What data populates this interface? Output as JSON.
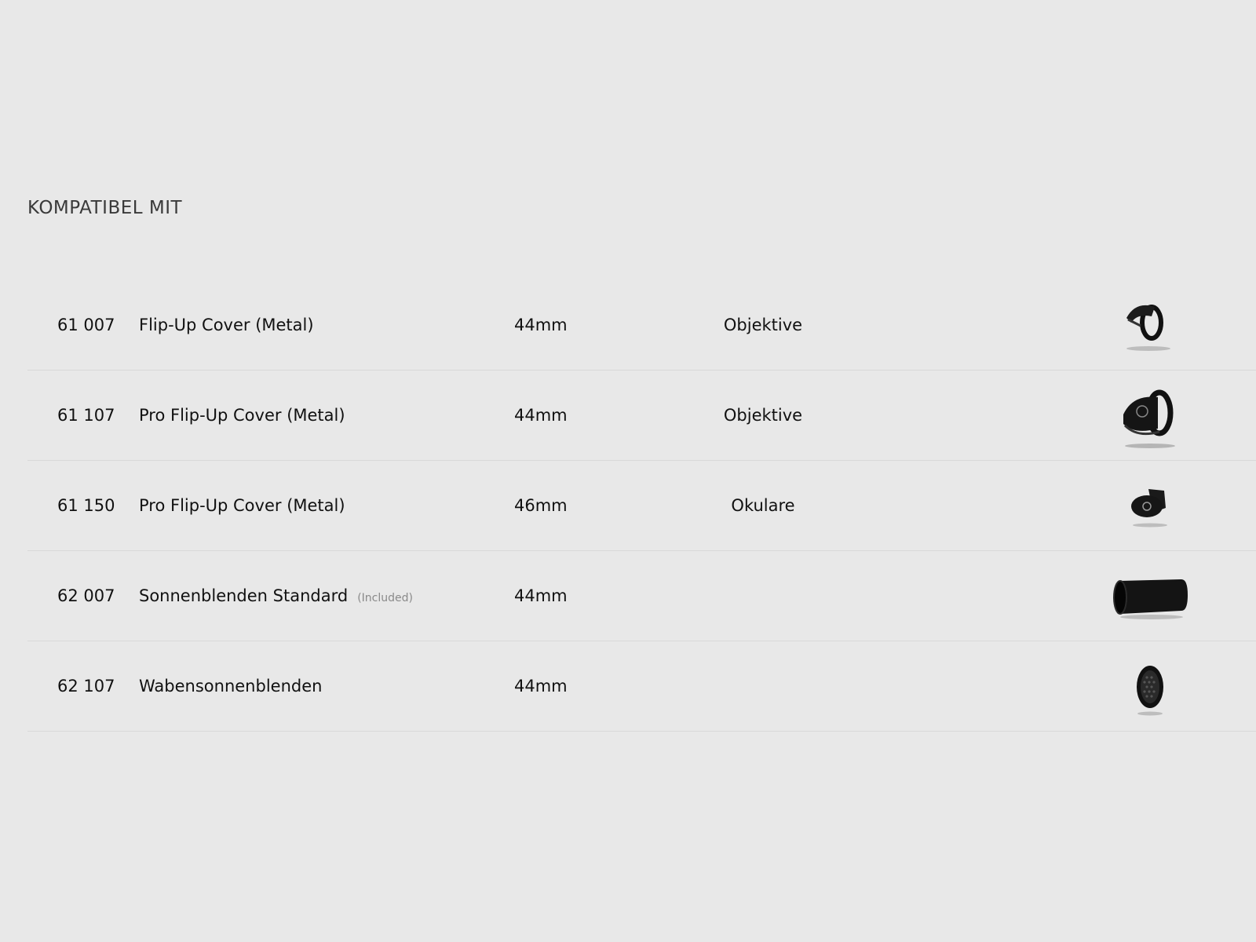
{
  "section": {
    "title": "KOMPATIBEL MIT"
  },
  "products": [
    {
      "number": "61 007",
      "name": "Flip-Up Cover (Metal)",
      "note": "",
      "size": "44mm",
      "type": "Objektive",
      "image": "flip-up-cover-icon"
    },
    {
      "number": "61 107",
      "name": "Pro Flip-Up Cover (Metal)",
      "note": "",
      "size": "44mm",
      "type": "Objektive",
      "image": "pro-flip-up-cover-icon"
    },
    {
      "number": "61 150",
      "name": "Pro Flip-Up Cover (Metal)",
      "note": "",
      "size": "46mm",
      "type": "Okulare",
      "image": "eyepiece-cover-icon"
    },
    {
      "number": "62 007",
      "name": "Sonnenblenden Standard",
      "note": "(Included)",
      "size": "44mm",
      "type": "",
      "image": "sunshade-tube-icon"
    },
    {
      "number": "62 107",
      "name": "Wabensonnenblenden",
      "note": "",
      "size": "44mm",
      "type": "",
      "image": "honeycomb-sunshade-icon"
    }
  ]
}
